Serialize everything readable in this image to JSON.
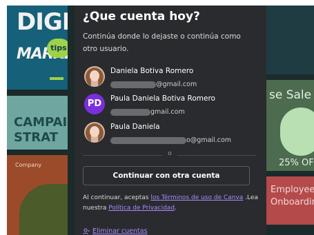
{
  "background": {
    "tile1": {
      "line1": "DIGIT",
      "line2": "MARKE",
      "badge": "tips"
    },
    "tile2": {
      "line1": "CAMPAIG",
      "line2": "STRAT"
    },
    "tile3": {
      "label": "Company"
    },
    "tile5": {
      "line1": "se Sale",
      "line2": "25% OF"
    },
    "tile6": {
      "line1": "Employee",
      "line2": "Onboardin"
    }
  },
  "modal": {
    "title": "¿Que cuenta hoy?",
    "subtitle": "Continúa donde lo dejaste o continúa como otro usuario.",
    "accounts": [
      {
        "name": "Daniela Botiva Romero",
        "email_visible": "@gmail.com",
        "avatar": "photo"
      },
      {
        "name": "Paula Daniela Botiva Romero",
        "email_visible": "gmail.com",
        "avatar_initials": "PD",
        "avatar_color": "#7b2fdc"
      },
      {
        "name": "Paula Daniela",
        "email_visible": "o@gmail.com",
        "avatar": "photo"
      }
    ],
    "divider_text": "o",
    "continue_button": "Continuar con otra cuenta",
    "legal": {
      "prefix": "Al continuar, aceptas ",
      "terms_link": "los Términos de uso de Canva",
      "middle": " .Lea nuestra ",
      "privacy_link": "Política de Privacidad",
      "suffix": "."
    },
    "remove_accounts": "Eliminar cuentas",
    "accent_color": "#a78bfa"
  }
}
